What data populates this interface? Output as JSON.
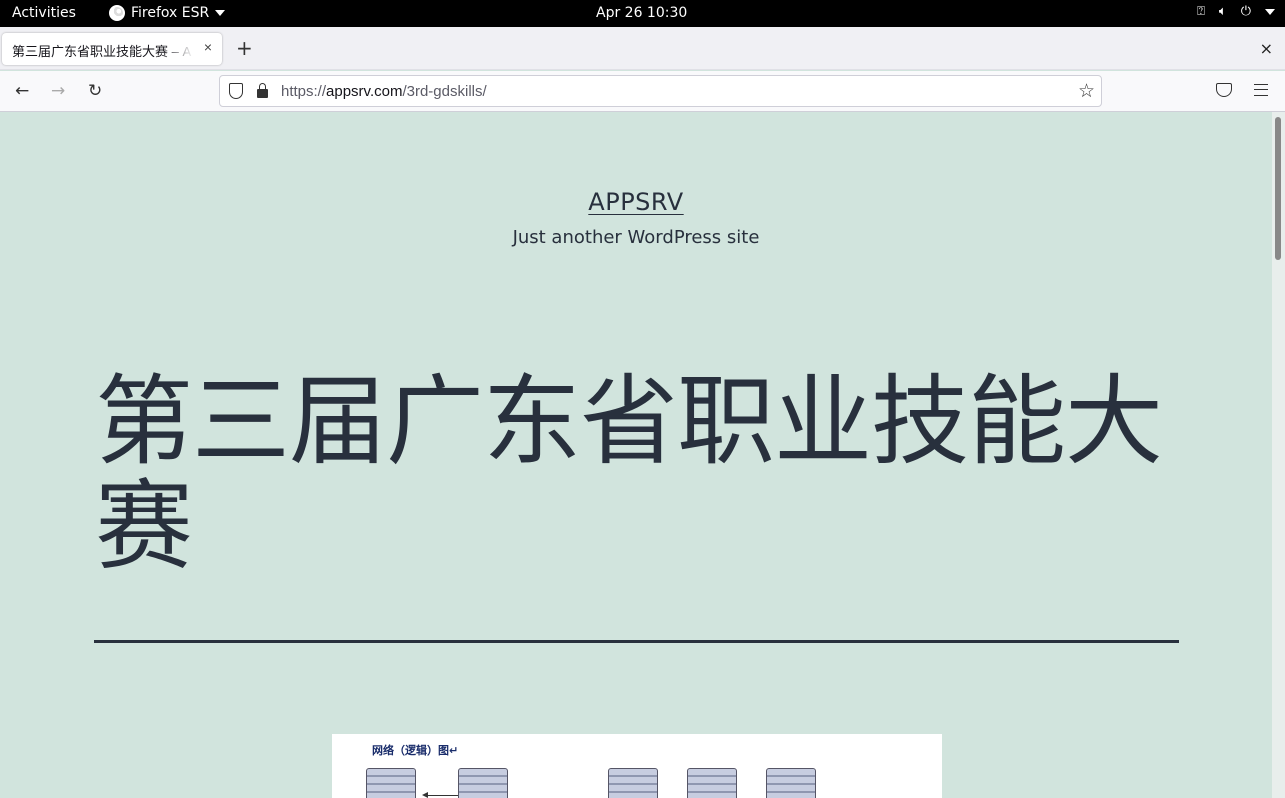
{
  "system_bar": {
    "activities": "Activities",
    "app_name": "Firefox ESR",
    "clock": "Apr 26  10:30",
    "icons": [
      "network-icon",
      "volume-icon",
      "power-icon",
      "chevron-down-icon"
    ]
  },
  "browser": {
    "tab_title": "第三届广东省职业技能大赛 – APPSRV",
    "new_tab": "+",
    "close_tab": "×",
    "close_window": "×",
    "url_host": "appsrv.com",
    "url_path": "/3rd-gdskills/",
    "url_scheme": "https://"
  },
  "page": {
    "site_title": "APPSRV",
    "site_description": "Just another WordPress site",
    "entry_title": "第三届广东省职业技能大赛",
    "figure_caption": "网络（逻辑）图↵"
  },
  "colors": {
    "page_background": "#d1e4dd",
    "text": "#28303d"
  }
}
